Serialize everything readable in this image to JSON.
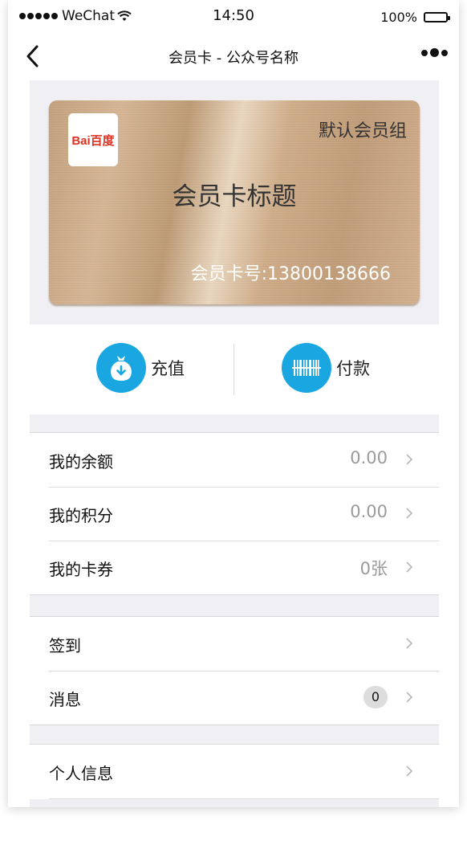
{
  "status_bar": {
    "carrier": "WeChat",
    "time": "14:50",
    "battery": "100%"
  },
  "navbar": {
    "title": "会员卡 - 公众号名称"
  },
  "card": {
    "logo_text": "Bai百度",
    "group_name": "默认会员组",
    "title": "会员卡标题",
    "card_number": "会员卡号:13800138666"
  },
  "actions": [
    {
      "label": "充值",
      "icon": "money-bag-icon"
    },
    {
      "label": "付款",
      "icon": "barcode-icon"
    }
  ],
  "section1": [
    {
      "label": "我的余额",
      "value": "0.00"
    },
    {
      "label": "我的积分",
      "value": "0.00"
    },
    {
      "label": "我的卡券",
      "value": "0张"
    }
  ],
  "section2": [
    {
      "label": "签到"
    },
    {
      "label": "消息",
      "badge": "0"
    }
  ],
  "section3": [
    {
      "label": "个人信息"
    }
  ],
  "colors": {
    "accent": "#1aa7e1",
    "background": "#efeff4"
  }
}
